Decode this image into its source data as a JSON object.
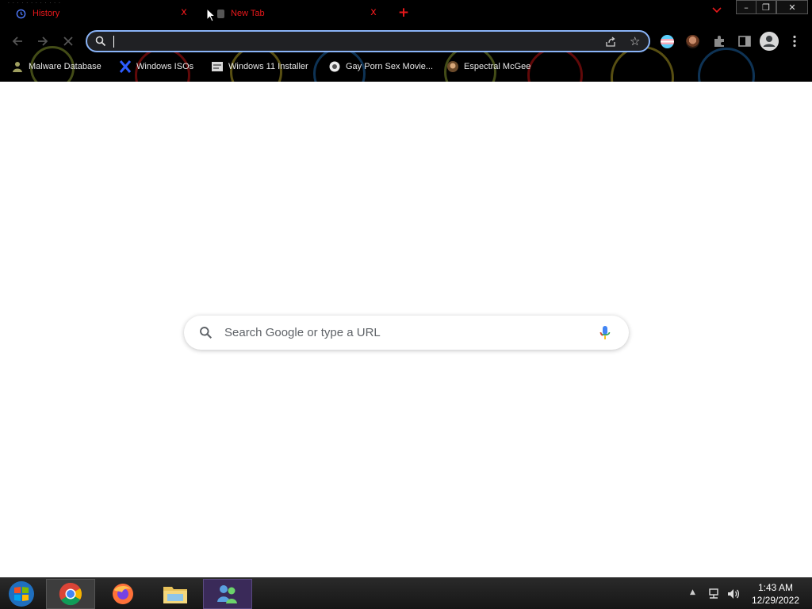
{
  "tabs": [
    {
      "title": "History",
      "favicon": "history-icon",
      "close_glyph": "x"
    },
    {
      "title": "New Tab",
      "favicon": "newtab-icon",
      "close_glyph": "x"
    }
  ],
  "new_tab_glyph": "+",
  "window_controls": {
    "minimize": "–",
    "maximize": "❐",
    "close": "✕"
  },
  "omnibox": {
    "value": "",
    "placeholder": ""
  },
  "bookmarks": [
    {
      "label": "Malware Database",
      "icon": "malware-icon"
    },
    {
      "label": "Windows ISOs",
      "icon": "x-logo-icon"
    },
    {
      "label": "Windows 11 Installer",
      "icon": "installer-icon"
    },
    {
      "label": "Gay Porn Sex Movie...",
      "icon": "site-icon"
    },
    {
      "label": "Espectral McGee",
      "icon": "avatar-icon"
    }
  ],
  "ntp_search": {
    "placeholder": "Search Google or type a URL"
  },
  "taskbar": {
    "apps": [
      "start-orb",
      "chrome",
      "firefox",
      "file-explorer",
      "messenger"
    ],
    "time": "1:43 AM",
    "date": "12/29/2022"
  },
  "colors": {
    "tab_text": "#e8181b",
    "omnibox_border": "#8ab4f8",
    "page_bg": "#ffffff"
  }
}
